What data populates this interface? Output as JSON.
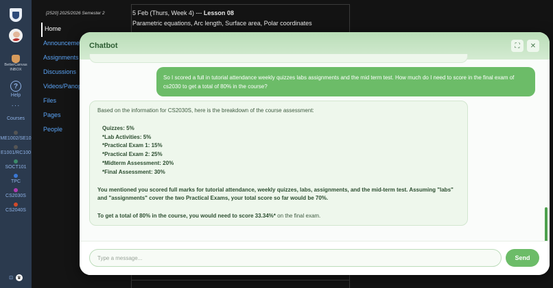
{
  "rail": {
    "tool_label_1": "BetterCanvas",
    "tool_label_2": "INBOX",
    "help_label": "Help",
    "more": "···",
    "courses_label": "Courses",
    "courses": [
      {
        "name": "ME1002/SE10",
        "color": "#555555"
      },
      {
        "name": "E1001/RC100",
        "color": "#555555"
      },
      {
        "name": "SOCT101",
        "color": "#3c8a6a"
      },
      {
        "name": "TPC",
        "color": "#3b78d4"
      },
      {
        "name": "CS2030S",
        "color": "#b03ab0"
      },
      {
        "name": "CS2040S",
        "color": "#d24a2a"
      }
    ],
    "bottom_a": "⊡",
    "bottom_b": "♛"
  },
  "coursenav": {
    "semester": "[2520] 2025/2026 Semester 2",
    "items": [
      "Home",
      "Announcements",
      "Assignments",
      "Discussions",
      "Videos/Panopto",
      "Files",
      "Pages",
      "People"
    ]
  },
  "lesson": {
    "title_prefix": "5 Feb (Thurs, Week 4) --- ",
    "title_bold": "Lesson 08",
    "subtitle": "Parametric equations, Arc length, Surface area, Polar coordinates"
  },
  "chat": {
    "title": "Chatbot",
    "expand_icon": "⛶",
    "close_icon": "✕",
    "user_message": "So I scored a full in tutorial attendance weekly quizzes labs assignments and the mid term test. How much do I need to score in the final exam of cs2030 to get a total of 80% in the course?",
    "bot": {
      "intro": "Based on the information for CS2030S, here is the breakdown of the course assessment:",
      "items": [
        "Quizzes: 5%",
        "*Lab Activities: 5%",
        "*Practical Exam 1: 15%",
        "*Practical Exam 2: 25%",
        "*Midterm Assessment: 20%",
        "*Final Assessment: 30%"
      ],
      "para1": "You mentioned you scored full marks for tutorial attendance, weekly quizzes, labs, assignments, and the mid-term test. Assuming \"labs\" and \"assignments\" cover the two Practical Exams, your total score so far would be 70%.",
      "para2_bold": "To get a total of 80% in the course, you would need to score 33.34%*",
      "para2_rest": " on the final exam."
    },
    "input_placeholder": "Type a message...",
    "send_label": "Send",
    "accent": "#6cbc68"
  }
}
